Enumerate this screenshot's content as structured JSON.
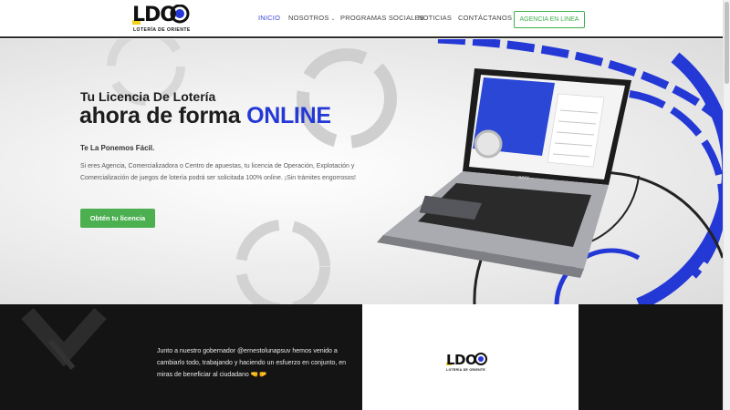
{
  "header": {
    "logo_text": "LDO",
    "logo_subtitle": "LOTERÍA DE ORIENTE",
    "nav": [
      "INICIO",
      "NOSOTROS",
      "PROGRAMAS SOCIALES",
      "NOTICIAS",
      "CONTÁCTANOS"
    ],
    "agency_button": "AGENCIA EN LINEA"
  },
  "hero": {
    "title_line1": "Tu Licencia De Lotería",
    "title_line2_prefix": "ahora de forma ",
    "title_line2_accent": "ONLINE",
    "tagline": "Te La Ponemos Fácil.",
    "description": "Si eres Agencia, Comercializadora o Centro de apuestas, tu licencia de Operación, Explotación y Comercialización de juegos de lotería podrá ser solicitada 100% online. ¡Sin trámites engorrosos!",
    "cta_button": "Obtén tu licencia"
  },
  "band": {
    "text": "Junto a nuestro gobernador @ernestolunapsuv hemos venido a cambiarlo todo, trabajando y haciendo un esfuerzo en conjunto, en miras de beneficiar al ciudadano 🤜🤛",
    "logo_text": "LDO",
    "logo_subtitle": "LOTERÍA DE ORIENTE"
  },
  "colors": {
    "accent_blue": "#2438d6",
    "nav_active": "#3b48d8",
    "green": "#4caf50"
  }
}
